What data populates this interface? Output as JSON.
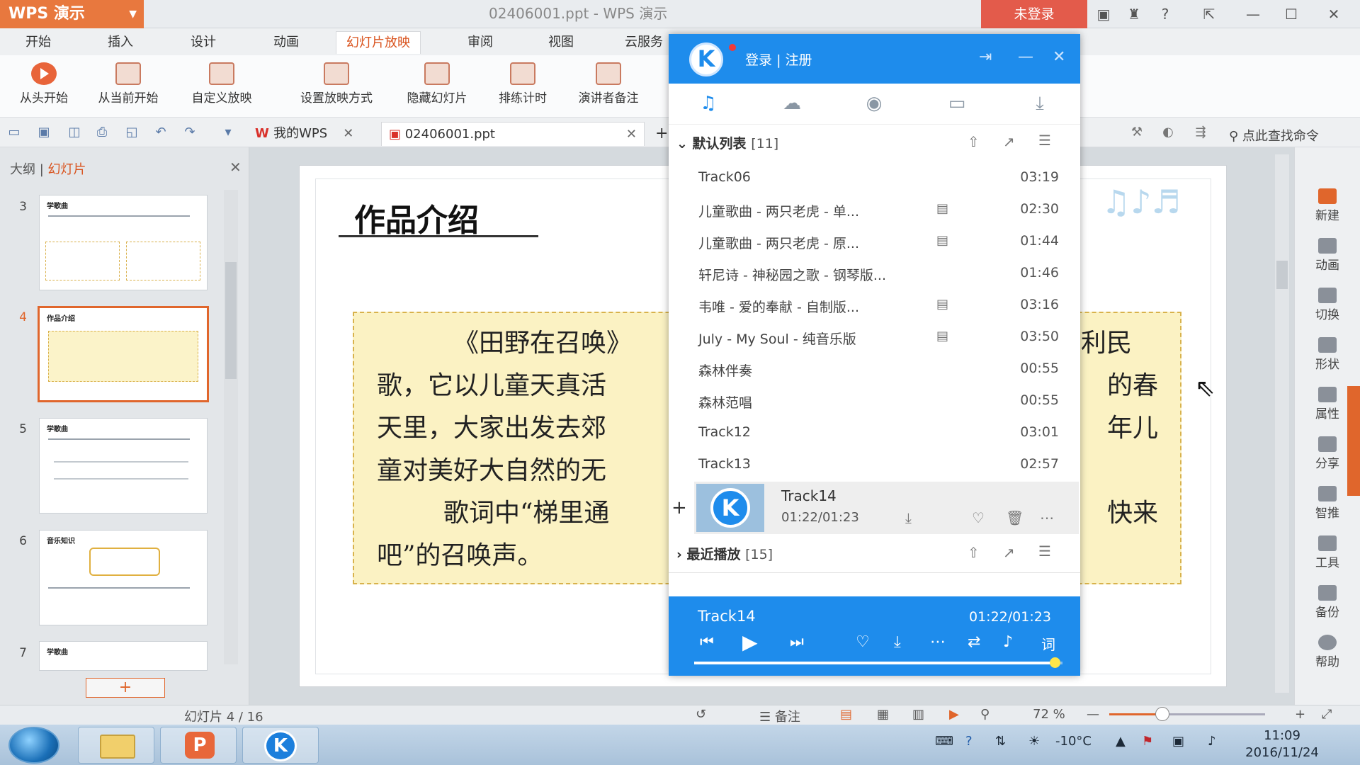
{
  "window": {
    "app_name": "WPS 演示",
    "doc_title": "02406001.ppt - WPS 演示",
    "login_button": "未登录"
  },
  "menu_tabs": [
    "开始",
    "插入",
    "设计",
    "动画",
    "幻灯片放映",
    "审阅",
    "视图",
    "云服务"
  ],
  "ribbon": {
    "buttons": [
      "从头开始",
      "从当前开始",
      "自定义放映",
      "设置放映方式",
      "隐藏幻灯片",
      "排练计时",
      "演讲者备注"
    ]
  },
  "doc_tabs": {
    "my_wps": "我的WPS",
    "doc": "02406001.ppt",
    "search_command": "点此查找命令"
  },
  "left_panel": {
    "tab_outline": "大纲",
    "tab_slides": "幻灯片",
    "slides": [
      {
        "num": "3",
        "title": "学歌曲"
      },
      {
        "num": "4",
        "title": "作品介绍"
      },
      {
        "num": "5",
        "title": "学歌曲"
      },
      {
        "num": "6",
        "title": "音乐知识"
      },
      {
        "num": "7",
        "title": "学歌曲"
      }
    ],
    "add_slide": "+"
  },
  "slide": {
    "title": "作品介绍",
    "lines": [
      "《田野在召唤》",
      "歌，它以儿童天真活",
      "天里，大家出发去郊",
      "童对美好大自然的无",
      "歌词中“梯里通",
      "吧”的召唤声。"
    ],
    "right_fragments": [
      "利民",
      "的春",
      "年儿",
      "快来"
    ]
  },
  "right_rail": [
    "新建",
    "动画",
    "切换",
    "形状",
    "属性",
    "分享",
    "智推",
    "工具",
    "备份",
    "帮助"
  ],
  "status": {
    "slide_counter": "幻灯片 4 / 16",
    "notes": "备注",
    "zoom": "72 %",
    "zoom_level": 0.34
  },
  "kugou": {
    "login": "登录",
    "separator": "|",
    "register": "注册",
    "nav_icons": [
      "music-note-icon",
      "cloud-icon",
      "radio-icon",
      "device-icon",
      "download-icon"
    ],
    "default_list_label": "默认列表",
    "default_list_count": "[11]",
    "tracks": [
      {
        "name": "Track06",
        "duration": "03:19",
        "mv": false
      },
      {
        "name": "儿童歌曲 - 两只老虎 - 单...",
        "duration": "02:30",
        "mv": true
      },
      {
        "name": "儿童歌曲 - 两只老虎 - 原...",
        "duration": "01:44",
        "mv": true
      },
      {
        "name": "轩尼诗 - 神秘园之歌 - 钢琴版...",
        "duration": "01:46",
        "mv": false
      },
      {
        "name": "韦唯 - 爱的奉献 - 自制版...",
        "duration": "03:16",
        "mv": true
      },
      {
        "name": "July - My Soul - 纯音乐版",
        "duration": "03:50",
        "mv": true
      },
      {
        "name": "森林伴奏",
        "duration": "00:55",
        "mv": false
      },
      {
        "name": "森林范唱",
        "duration": "00:55",
        "mv": false
      },
      {
        "name": "Track12",
        "duration": "03:01",
        "mv": false
      },
      {
        "name": "Track13",
        "duration": "02:57",
        "mv": false
      }
    ],
    "now_playing": {
      "name": "Track14",
      "time": "01:22/01:23",
      "plus": "+"
    },
    "recent_label": "最近播放",
    "recent_count": "[15]",
    "player_bar": {
      "name": "Track14",
      "time": "01:22/01:23",
      "lyrics": "词",
      "progress": 0.98
    }
  },
  "taskbar": {
    "temperature": "-10°C",
    "time": "11:09",
    "date": "2016/11/24",
    "wps_glyph": "P",
    "kugou_glyph": "K"
  },
  "colors": {
    "wps_orange": "#e8783e",
    "kugou_blue": "#1e8cec",
    "login_red": "#e35b4b",
    "slide_box": "#fbf2c3"
  }
}
